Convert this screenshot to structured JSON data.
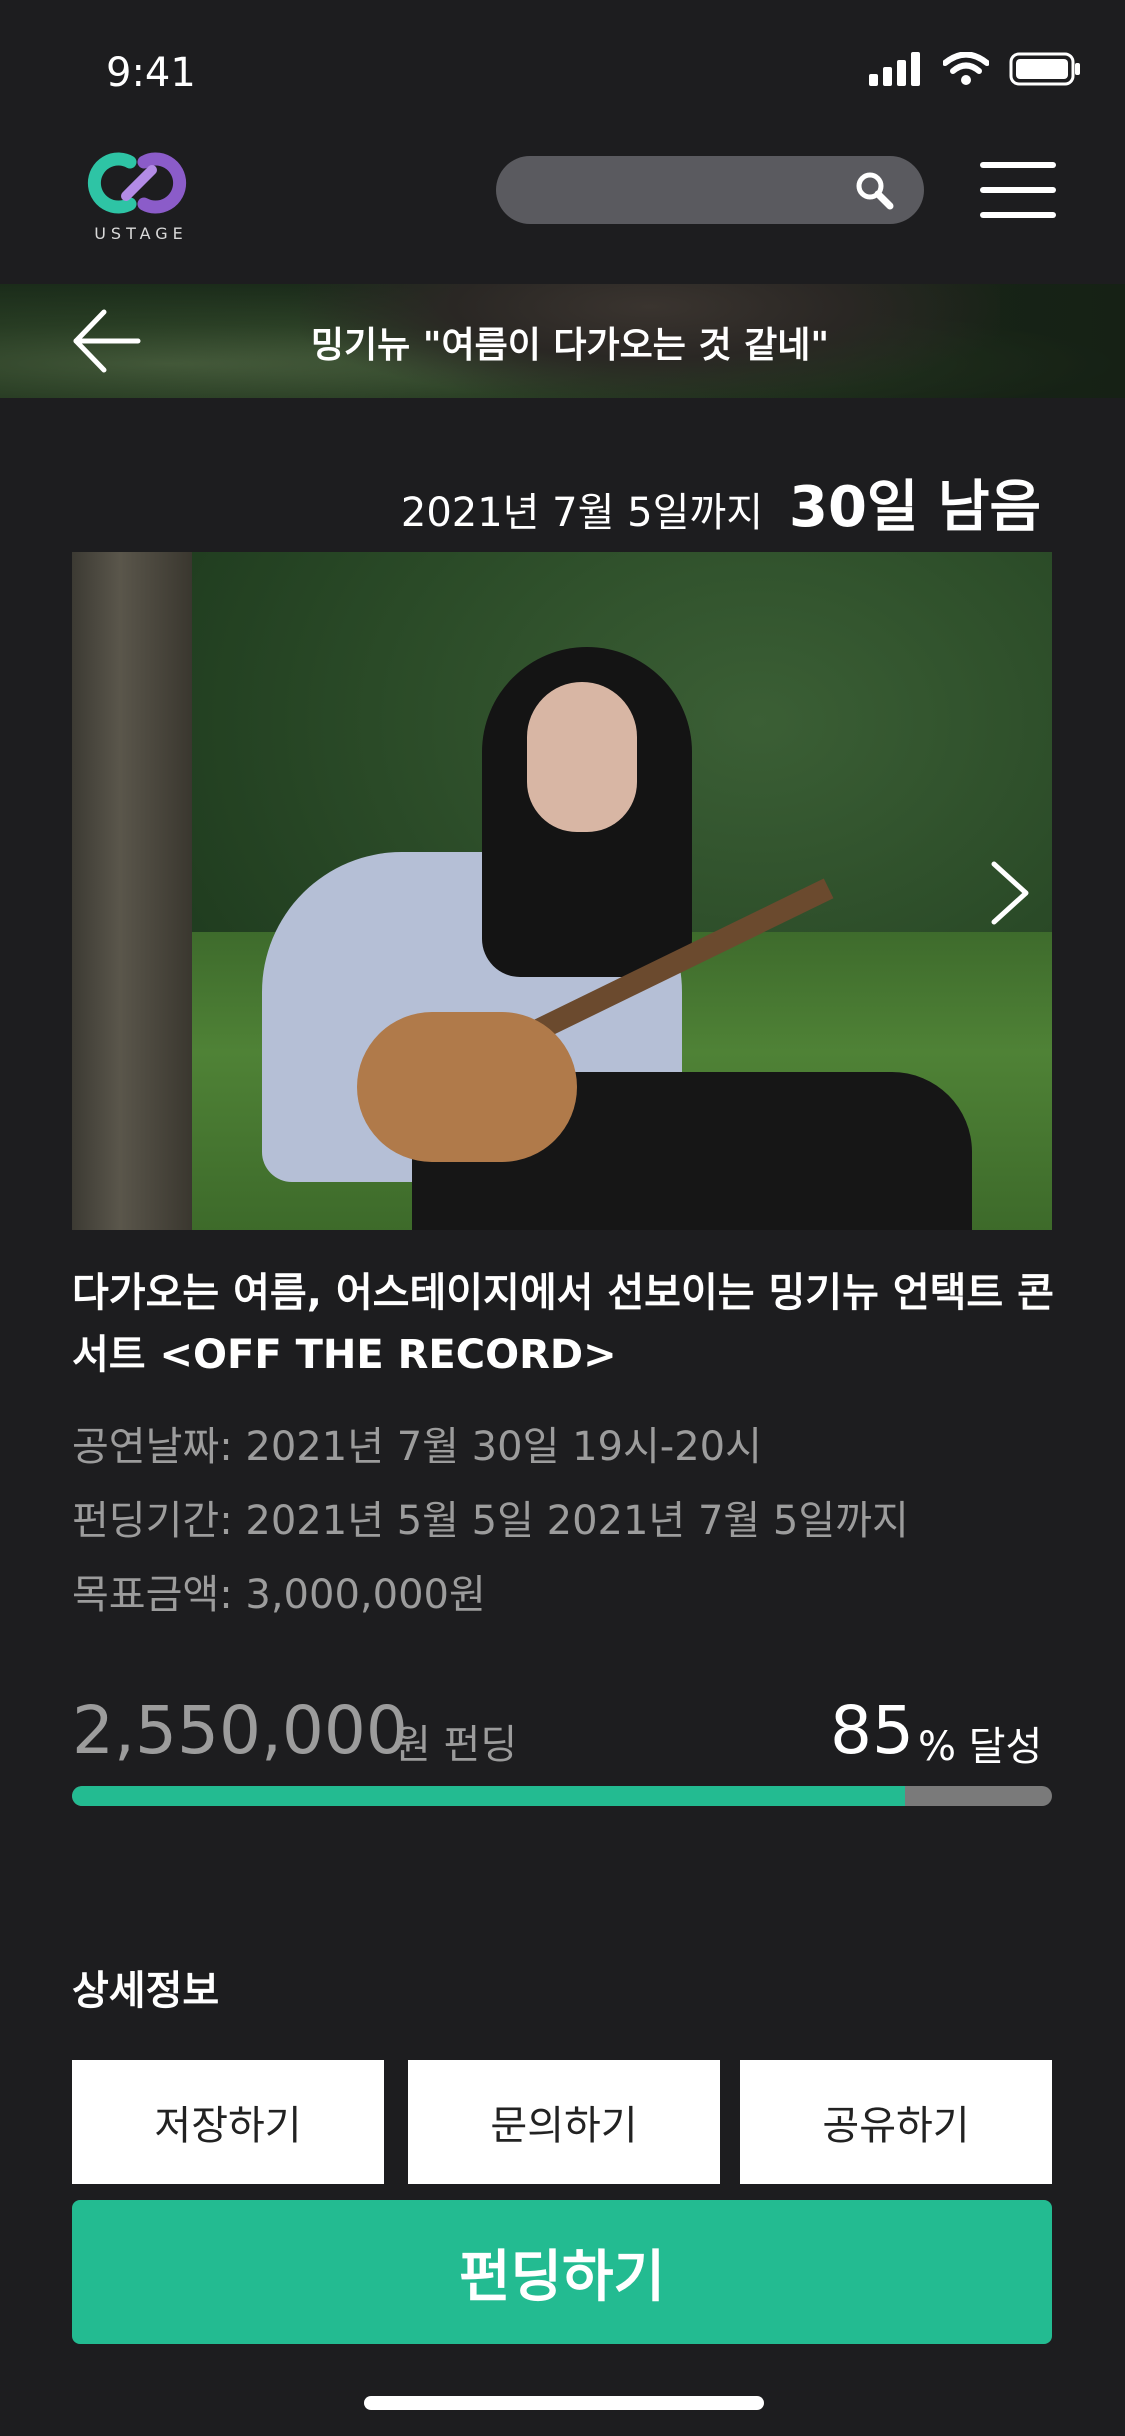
{
  "status_bar": {
    "time": "9:41"
  },
  "brand": {
    "logo_text": "USTAGE",
    "colors": [
      "#2ec4a5",
      "#8b5cc9"
    ]
  },
  "search": {
    "placeholder": ""
  },
  "banner": {
    "title": "밍기뉴 \"여름이 다가오는 것 같네\""
  },
  "deadline": {
    "date_text": "2021년 7월 5일까지",
    "remaining": "30일 남음"
  },
  "event": {
    "title": "다가오는 여름, 어스테이지에서 선보이는 밍기뉴 언택트 콘서트 <OFF THE RECORD>",
    "info_lines": [
      "공연날짜: 2021년 7월 30일 19시-20시",
      "펀딩기간: 2021년 5월 5일 2021년 7월 5일까지",
      "목표금액: 3,000,000원"
    ]
  },
  "funding": {
    "amount": "2,550,000",
    "amount_unit": "원 펀딩",
    "percent": "85",
    "percent_unit": "% 달성",
    "progress": 0.85
  },
  "detail": {
    "title": "상세정보",
    "actions": [
      "저장하기",
      "문의하기",
      "공유하기"
    ],
    "cta": "펀딩하기"
  },
  "colors": {
    "background": "#1d1d1f",
    "accent": "#23bb91"
  }
}
